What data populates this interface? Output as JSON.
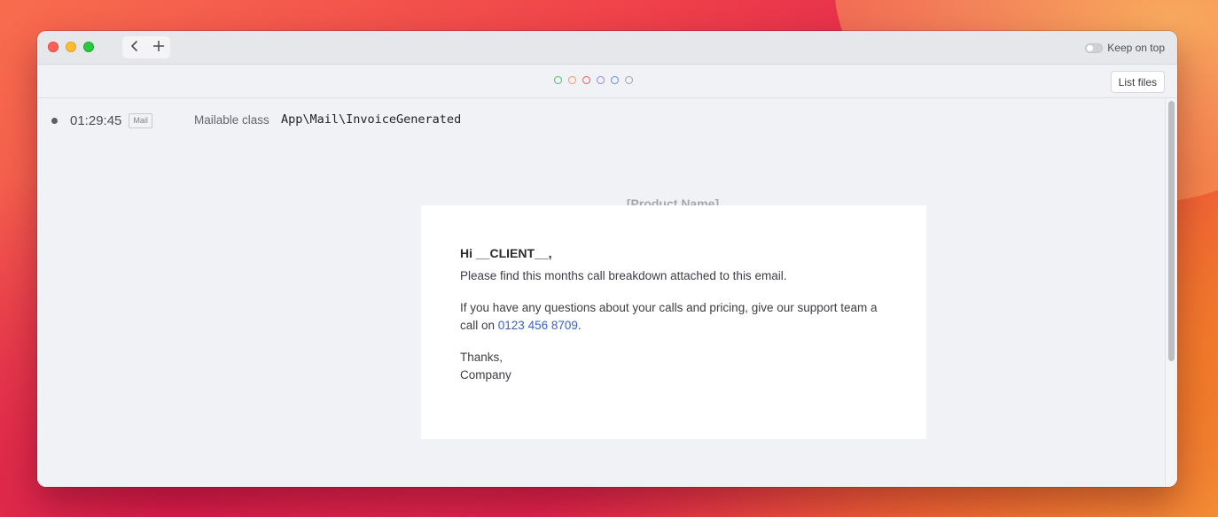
{
  "titlebar": {
    "back_icon": "chevron-left-icon",
    "add_icon": "plus-icon",
    "keep_on_top_label": "Keep on top",
    "keep_on_top_enabled": false
  },
  "toolbar": {
    "filter_dots": [
      {
        "name": "green",
        "color": "#3dc46a"
      },
      {
        "name": "orange",
        "color": "#f39a4a"
      },
      {
        "name": "red",
        "color": "#ef5b5b"
      },
      {
        "name": "purple",
        "color": "#9b7df0"
      },
      {
        "name": "blue",
        "color": "#5b8df0"
      },
      {
        "name": "gray",
        "color": "#9aa0ab"
      }
    ],
    "list_files_label": "List files"
  },
  "entry": {
    "time": "01:29:45",
    "type": "Mail",
    "class_label": "Mailable class",
    "class_value": "App\\Mail\\InvoiceGenerated"
  },
  "email": {
    "product_name": "[Product Name]",
    "greeting": "Hi __CLIENT__,",
    "line1": "Please find this months call breakdown attached to this email.",
    "line2_before": "If you have any questions about your calls and pricing, give our support team a call on ",
    "phone": "0123 456 8709",
    "line2_after": ".",
    "sign_thanks": "Thanks,",
    "sign_company": "Company"
  }
}
